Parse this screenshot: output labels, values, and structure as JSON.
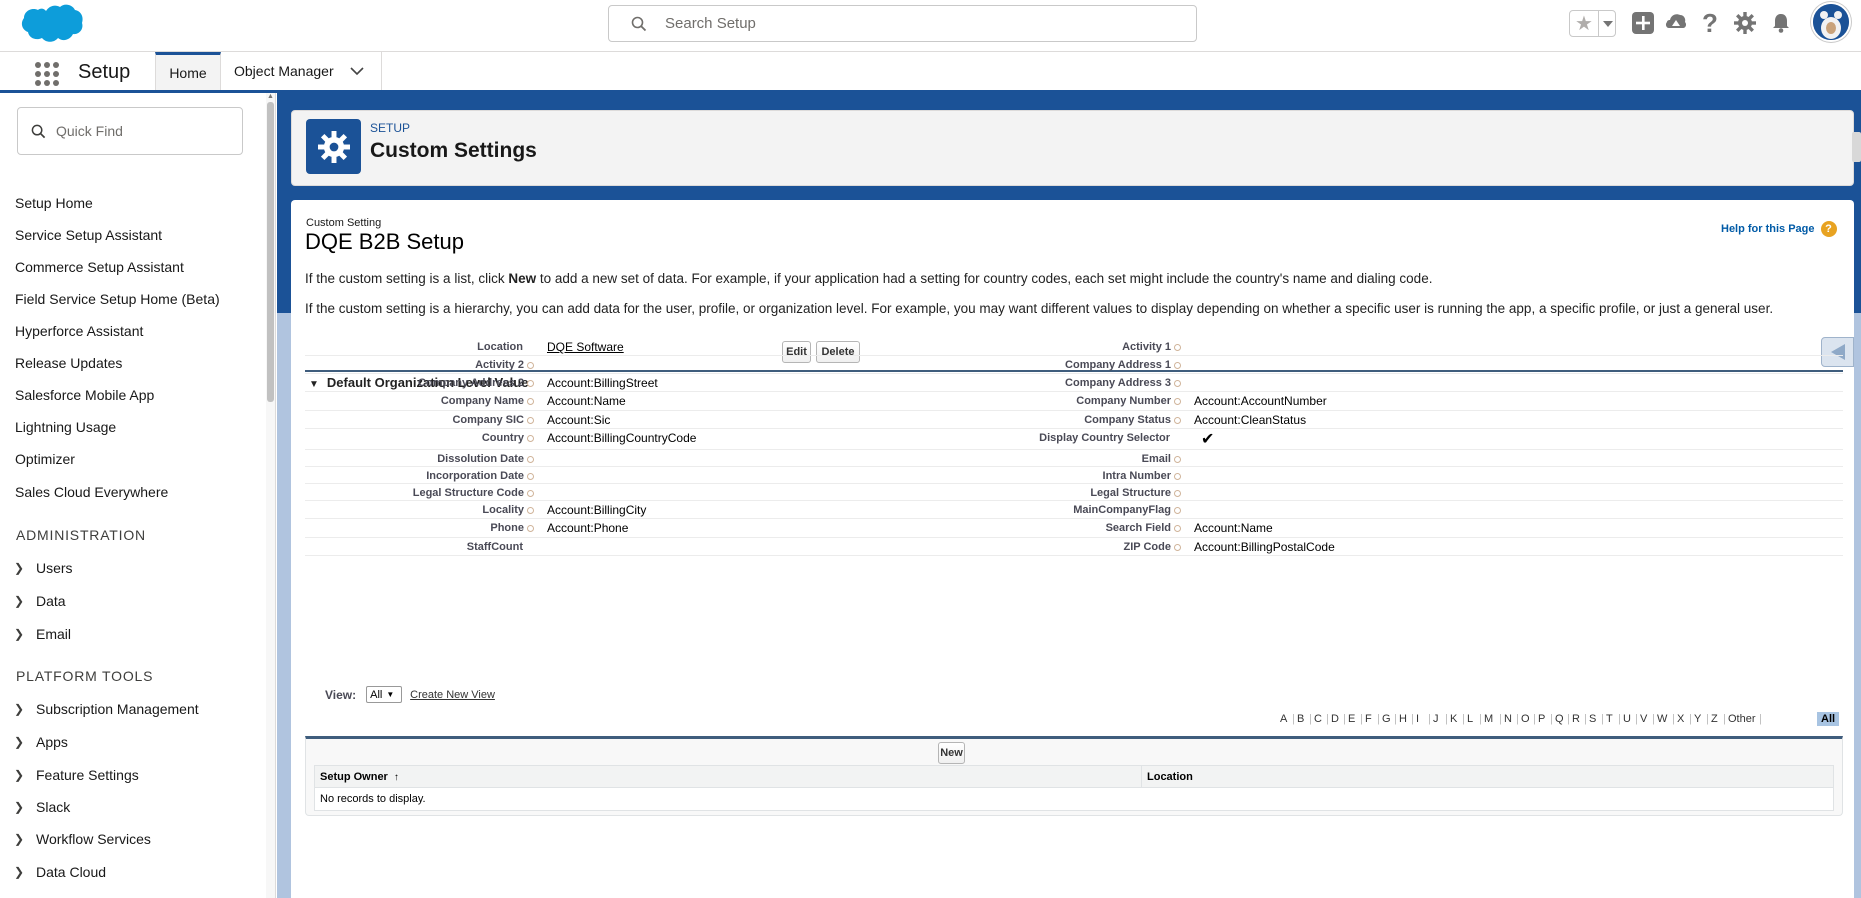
{
  "header": {
    "search_placeholder": "Search Setup"
  },
  "nav": {
    "app_name": "Setup",
    "tabs": [
      {
        "label": "Home"
      },
      {
        "label": "Object Manager"
      }
    ]
  },
  "sidebar": {
    "quick_find_placeholder": "Quick Find",
    "links": [
      "Setup Home",
      "Service Setup Assistant",
      "Commerce Setup Assistant",
      "Field Service Setup Home (Beta)",
      "Hyperforce Assistant",
      "Release Updates",
      "Salesforce Mobile App",
      "Lightning Usage",
      "Optimizer",
      "Sales Cloud Everywhere"
    ],
    "administration": {
      "heading": "ADMINISTRATION",
      "items": [
        "Users",
        "Data",
        "Email"
      ]
    },
    "platform_tools": {
      "heading": "PLATFORM TOOLS",
      "items": [
        "Subscription Management",
        "Apps",
        "Feature Settings",
        "Slack",
        "Workflow Services",
        "Data Cloud"
      ]
    }
  },
  "page_header": {
    "eyebrow": "SETUP",
    "title": "Custom Settings"
  },
  "detail": {
    "eyebrow": "Custom Setting",
    "title": "DQE B2B Setup",
    "help_link": "Help for this Page",
    "help_icon": "?",
    "info_list_pre": "If the custom setting is a list, click ",
    "info_list_bold": "New",
    "info_list_post": " to add a new set of data. For example, if your application had a setting for country codes, each set might include the country's name and dialing code.",
    "info_hierarchy": "If the custom setting is a hierarchy, you can add data for the user, profile, or organization level. For example, you may want different values to display depending on whether a specific user is running the app, a specific profile, or just a general user.",
    "edit_label": "Edit",
    "delete_label": "Delete",
    "section_title": "Default Organization Level Value",
    "fields": [
      {
        "left_label": "Location",
        "left_value": "DQE Software",
        "left_link": true,
        "left_help": false,
        "right_label": "Activity 1",
        "right_value": "",
        "right_help": true
      },
      {
        "left_label": "Activity 2",
        "left_value": "",
        "left_help": true,
        "right_label": "Company Address 1",
        "right_value": "",
        "right_help": true
      },
      {
        "left_label": "Company Address 2",
        "left_value": "Account:BillingStreet",
        "left_help": true,
        "right_label": "Company Address 3",
        "right_value": "",
        "right_help": true
      },
      {
        "left_label": "Company Name",
        "left_value": "Account:Name",
        "left_help": true,
        "right_label": "Company Number",
        "right_value": "Account:AccountNumber",
        "right_help": true
      },
      {
        "left_label": "Company SIC",
        "left_value": "Account:Sic",
        "left_help": true,
        "right_label": "Company Status",
        "right_value": "Account:CleanStatus",
        "right_help": true
      },
      {
        "left_label": "Country",
        "left_value": "Account:BillingCountryCode",
        "left_help": true,
        "right_label": "Display Country Selector",
        "right_value": "✔",
        "right_help": false
      },
      {
        "left_label": "Dissolution Date",
        "left_value": "",
        "left_help": true,
        "right_label": "Email",
        "right_value": "",
        "right_help": true
      },
      {
        "left_label": "Incorporation Date",
        "left_value": "",
        "left_help": true,
        "right_label": "Intra Number",
        "right_value": "",
        "right_help": true
      },
      {
        "left_label": "Legal Structure Code",
        "left_value": "",
        "left_help": true,
        "right_label": "Legal Structure",
        "right_value": "",
        "right_help": true
      },
      {
        "left_label": "Locality",
        "left_value": "Account:BillingCity",
        "left_help": true,
        "right_label": "MainCompanyFlag",
        "right_value": "",
        "right_help": true
      },
      {
        "left_label": "Phone",
        "left_value": "Account:Phone",
        "left_help": true,
        "right_label": "Search Field",
        "right_value": "Account:Name",
        "right_help": true
      },
      {
        "left_label": "StaffCount",
        "left_value": "",
        "left_help": false,
        "right_label": "ZIP Code",
        "right_value": "Account:BillingPostalCode",
        "right_help": true
      }
    ],
    "view_label": "View:",
    "view_selected": "All",
    "create_view_label": "Create New View",
    "alpha": [
      "A",
      "B",
      "C",
      "D",
      "E",
      "F",
      "G",
      "H",
      "I",
      "J",
      "K",
      "L",
      "M",
      "N",
      "O",
      "P",
      "Q",
      "R",
      "S",
      "T",
      "U",
      "V",
      "W",
      "X",
      "Y",
      "Z",
      "Other"
    ],
    "alpha_all": "All",
    "new_label": "New",
    "table": {
      "columns": [
        "Setup Owner",
        "Location"
      ],
      "sort_icon": "↑",
      "empty": "No records to display."
    }
  },
  "colors": {
    "brand": "#1b5297",
    "cloud": "#0d9dda",
    "help": "#e8a322",
    "alpha_all_bg": "#a8c4e2"
  }
}
